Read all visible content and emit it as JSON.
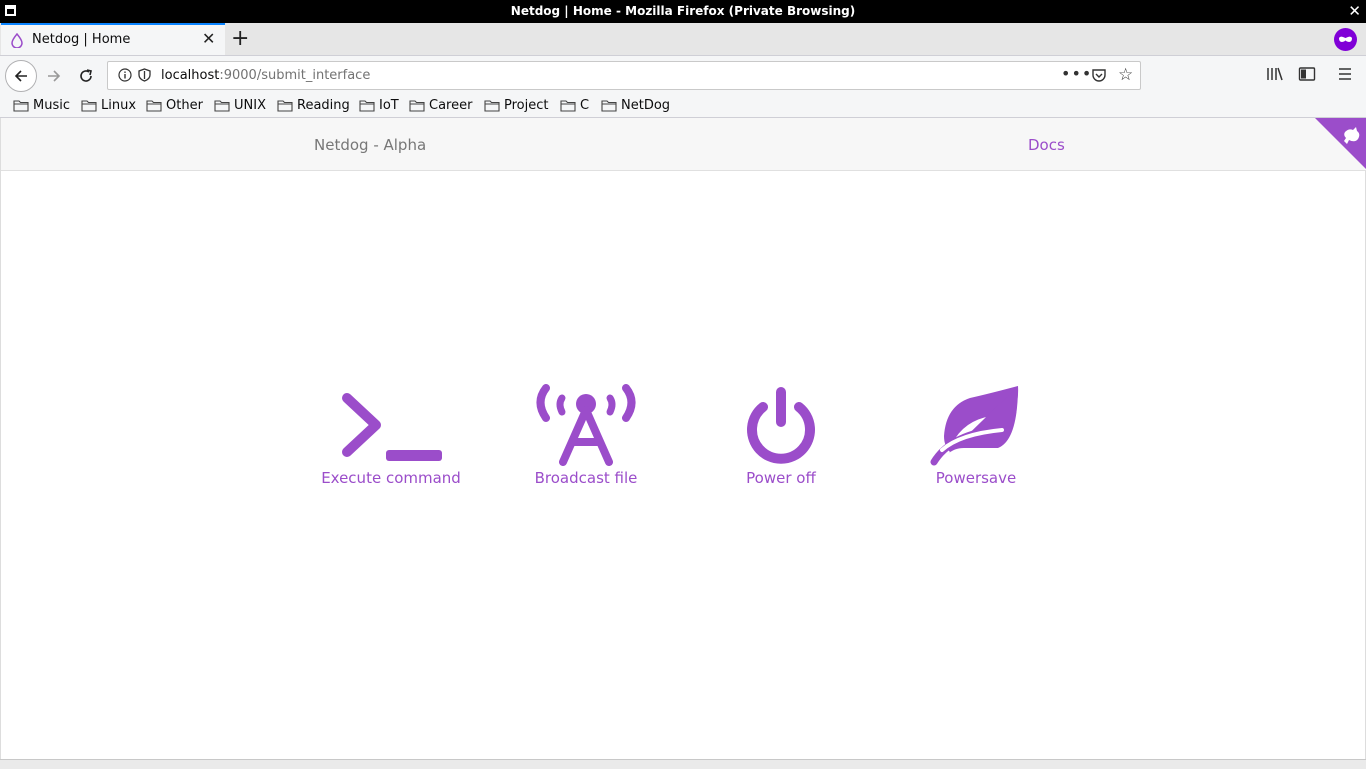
{
  "window": {
    "title": "Netdog | Home - Mozilla Firefox (Private Browsing)"
  },
  "tab": {
    "title": "Netdog | Home"
  },
  "urlbar": {
    "host": "localhost",
    "rest": ":9000/submit_interface"
  },
  "bookmarks": [
    {
      "label": "Music"
    },
    {
      "label": "Linux"
    },
    {
      "label": "Other"
    },
    {
      "label": "UNIX"
    },
    {
      "label": "Reading"
    },
    {
      "label": "IoT"
    },
    {
      "label": "Career"
    },
    {
      "label": "Project"
    },
    {
      "label": "C"
    },
    {
      "label": "NetDog"
    }
  ],
  "site": {
    "brand": "Netdog - Alpha",
    "docs_link": "Docs",
    "accent_color": "#9b4dca"
  },
  "actions": [
    {
      "label": "Execute command",
      "icon": "terminal-icon"
    },
    {
      "label": "Broadcast file",
      "icon": "broadcast-icon"
    },
    {
      "label": "Power off",
      "icon": "power-icon"
    },
    {
      "label": "Powersave",
      "icon": "leaf-icon"
    }
  ]
}
